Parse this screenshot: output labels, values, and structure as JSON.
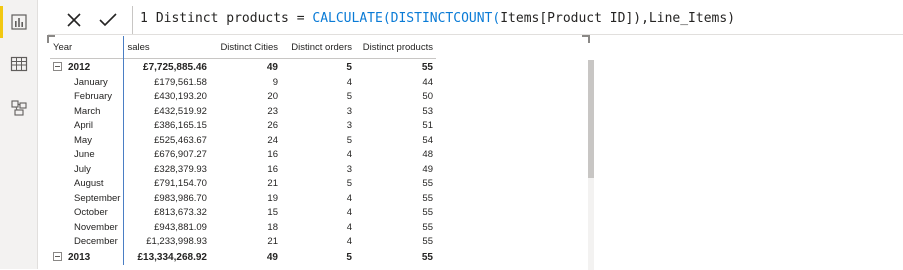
{
  "formula": {
    "line_number": "1",
    "text_prefix": "Distinct products = ",
    "function_part": "CALCULATE(DISTINCTCOUNT(",
    "text_suffix": "Items[Product ID]),Line_Items)"
  },
  "rail": {
    "items": [
      {
        "icon": "report-view-icon",
        "active": true
      },
      {
        "icon": "data-view-icon",
        "active": false
      },
      {
        "icon": "model-view-icon",
        "active": false
      }
    ]
  },
  "table": {
    "headers": [
      "Year",
      "sales",
      "Distinct Cities",
      "Distinct orders",
      "Distinct products"
    ],
    "rows": [
      {
        "kind": "total",
        "label": "2012",
        "sales": "£7,725,885.46",
        "cities": "49",
        "orders": "5",
        "products": "55"
      },
      {
        "kind": "sub",
        "label": "January",
        "sales": "£179,561.58",
        "cities": "9",
        "orders": "4",
        "products": "44"
      },
      {
        "kind": "sub",
        "label": "February",
        "sales": "£430,193.20",
        "cities": "20",
        "orders": "5",
        "products": "50"
      },
      {
        "kind": "sub",
        "label": "March",
        "sales": "£432,519.92",
        "cities": "23",
        "orders": "3",
        "products": "53"
      },
      {
        "kind": "sub",
        "label": "April",
        "sales": "£386,165.15",
        "cities": "26",
        "orders": "3",
        "products": "51"
      },
      {
        "kind": "sub",
        "label": "May",
        "sales": "£525,463.67",
        "cities": "24",
        "orders": "5",
        "products": "54"
      },
      {
        "kind": "sub",
        "label": "June",
        "sales": "£676,907.27",
        "cities": "16",
        "orders": "4",
        "products": "48"
      },
      {
        "kind": "sub",
        "label": "July",
        "sales": "£328,379.93",
        "cities": "16",
        "orders": "3",
        "products": "49"
      },
      {
        "kind": "sub",
        "label": "August",
        "sales": "£791,154.70",
        "cities": "21",
        "orders": "5",
        "products": "55"
      },
      {
        "kind": "sub",
        "label": "September",
        "sales": "£983,986.70",
        "cities": "19",
        "orders": "4",
        "products": "55"
      },
      {
        "kind": "sub",
        "label": "October",
        "sales": "£813,673.32",
        "cities": "15",
        "orders": "4",
        "products": "55"
      },
      {
        "kind": "sub",
        "label": "November",
        "sales": "£943,881.09",
        "cities": "18",
        "orders": "4",
        "products": "55"
      },
      {
        "kind": "sub",
        "label": "December",
        "sales": "£1,233,998.93",
        "cities": "21",
        "orders": "4",
        "products": "55"
      },
      {
        "kind": "total",
        "label": "2013",
        "sales": "£13,334,268.92",
        "cities": "49",
        "orders": "5",
        "products": "55"
      }
    ]
  },
  "colors": {
    "accent_yellow": "#f2c811",
    "function_blue": "#0a7bd6",
    "column_divider_blue": "#4a7ec4"
  }
}
